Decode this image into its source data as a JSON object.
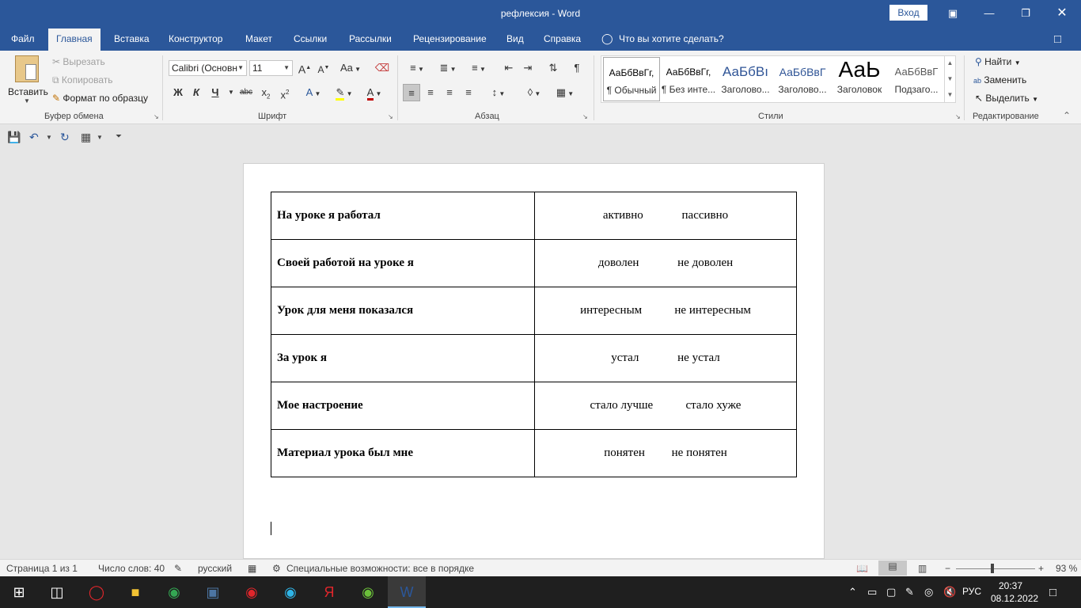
{
  "window": {
    "title": "рефлексия - Word",
    "signin_label": "Вход"
  },
  "ribbon_tabs": [
    "Файл",
    "Главная",
    "Вставка",
    "Конструктор",
    "Макет",
    "Ссылки",
    "Рассылки",
    "Рецензирование",
    "Вид",
    "Справка"
  ],
  "active_tab": "Главная",
  "tell_me": "Что вы хотите сделать?",
  "clipboard": {
    "paste": "Вставить",
    "cut": "Вырезать",
    "copy": "Копировать",
    "format_painter": "Формат по образцу",
    "group_label": "Буфер обмена"
  },
  "font": {
    "font_name": "Calibri (Основн",
    "font_size": "11",
    "group_label": "Шрифт",
    "bold_glyph": "Ж",
    "italic_glyph": "К",
    "underline_glyph": "Ч",
    "strike_glyph": "abc",
    "grow_glyph": "A",
    "shrink_glyph": "A",
    "case_glyph": "Aa",
    "font_color": "#c00000",
    "highlight_color": "#ffff00"
  },
  "paragraph": {
    "group_label": "Абзац",
    "pilcrow": "¶"
  },
  "styles": {
    "group_label": "Стили",
    "items": [
      {
        "sample": "АаБбВвГг,",
        "name": "¶ Обычный"
      },
      {
        "sample": "АаБбВвГг,",
        "name": "¶ Без инте..."
      },
      {
        "sample": "АаБбВı",
        "name": "Заголово..."
      },
      {
        "sample": "АаБбВвГ",
        "name": "Заголово..."
      },
      {
        "sample": "АаЬ",
        "name": "Заголовок"
      },
      {
        "sample": "АаБбВвГ",
        "name": "Подзаго..."
      }
    ]
  },
  "editing": {
    "find": "Найти",
    "replace": "Заменить",
    "select": "Выделить",
    "group_label": "Редактирование"
  },
  "table": {
    "rows": [
      {
        "question": "На уроке я работал",
        "answer": "активно             пассивно"
      },
      {
        "question": "Своей работой на уроке я",
        "answer": "доволен             не доволен"
      },
      {
        "question": "Урок для меня показался",
        "answer": "интересным           не интересным"
      },
      {
        "question": "За урок я",
        "answer": "устал             не устал"
      },
      {
        "question": "Мое настроение",
        "answer": "стало лучше           стало хуже"
      },
      {
        "question": "Материал урока был мне",
        "answer": "понятен         не понятен"
      }
    ]
  },
  "status": {
    "page": "Страница 1 из 1",
    "words": "Число слов: 40",
    "language": "русский",
    "accessibility": "Специальные возможности: все в порядке",
    "zoom": "93 %"
  },
  "taskbar": {
    "language": "РУС",
    "time": "20:37",
    "date": "08.12.2022",
    "apps": [
      "opera",
      "file-explorer",
      "chrome",
      "vk",
      "yandex-browser",
      "edge",
      "yandex",
      "app-green",
      "word"
    ]
  },
  "colors": {
    "word_blue": "#2b579a",
    "ribbon_bg": "#f3f3f3",
    "canvas_bg": "#e6e6e6"
  }
}
